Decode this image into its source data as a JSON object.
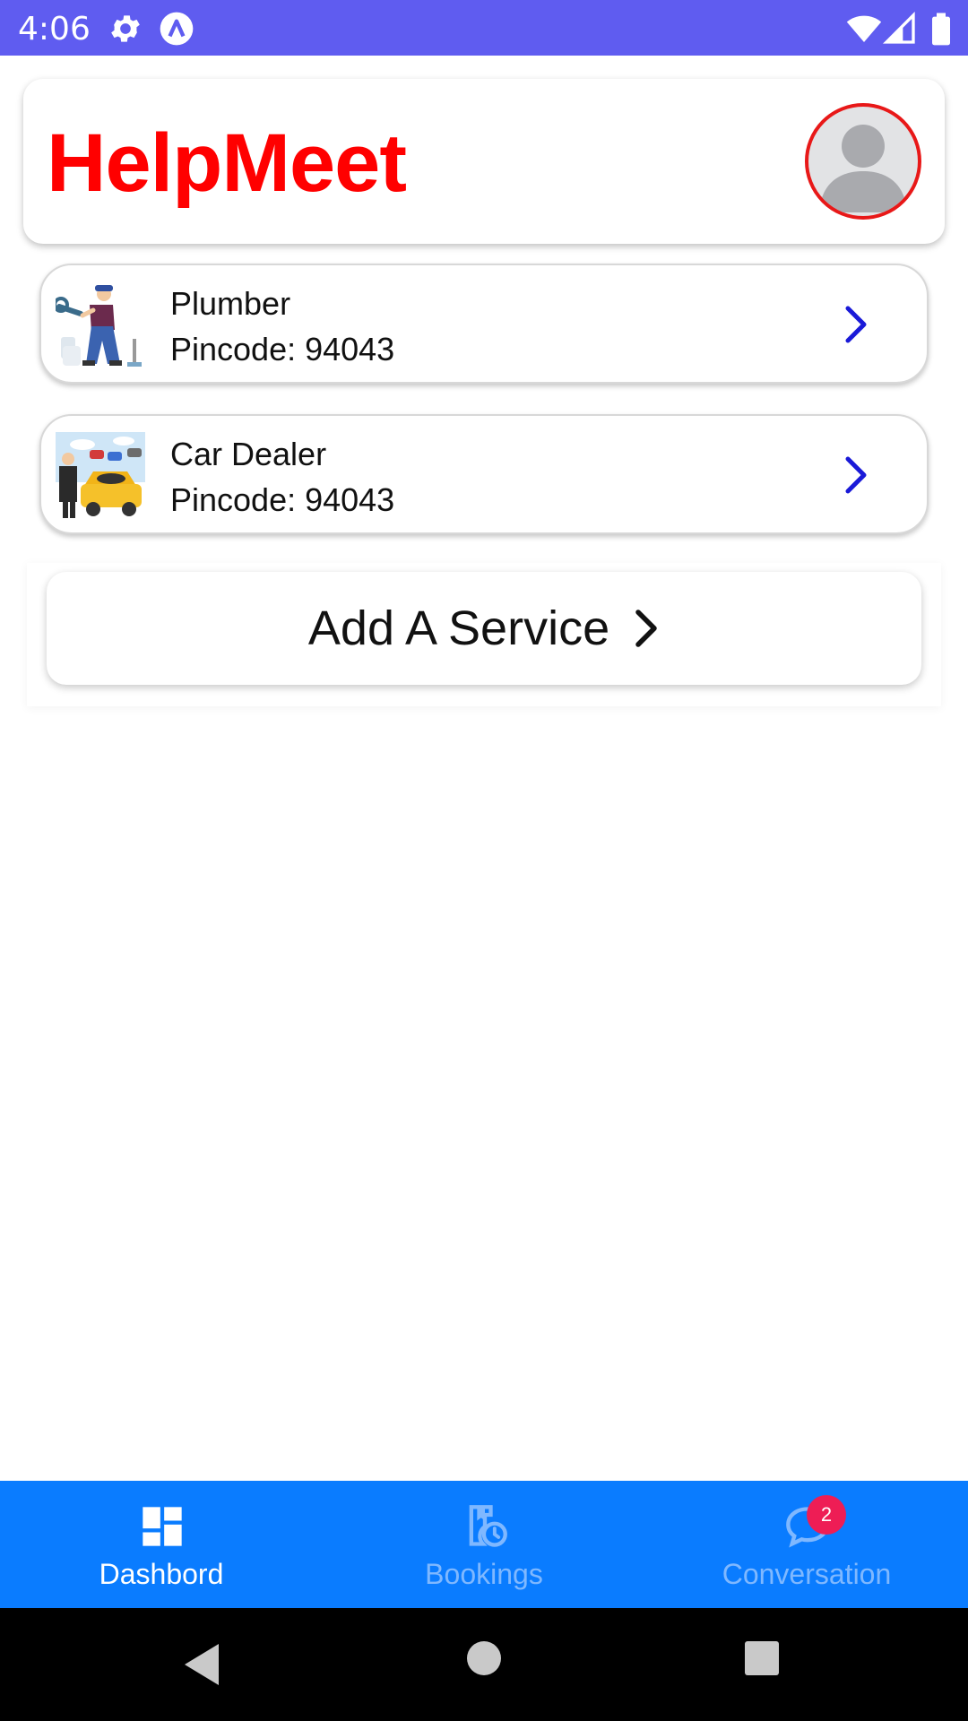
{
  "status_bar": {
    "time": "4:06",
    "icons": [
      "gear-icon",
      "app-logo-icon",
      "wifi-icon",
      "signal-icon",
      "battery-icon"
    ]
  },
  "header": {
    "title": "HelpMeet",
    "title_color": "#ff0000",
    "avatar_icon": "user-avatar-icon"
  },
  "services": [
    {
      "name": "Plumber",
      "pincode": "Pincode: 94043",
      "image": "plumber-thumbnail"
    },
    {
      "name": "Car Dealer",
      "pincode": "Pincode: 94043",
      "image": "car-dealer-thumbnail"
    }
  ],
  "add_service": {
    "label": "Add A Service"
  },
  "bottom_nav": {
    "background": "#0a7cff",
    "items": [
      {
        "label": "Dashbord",
        "icon": "dashboard-icon",
        "active": true
      },
      {
        "label": "Bookings",
        "icon": "bookings-icon",
        "active": false
      },
      {
        "label": "Conversation",
        "icon": "chat-icon",
        "active": false,
        "badge": "2"
      }
    ]
  },
  "system_nav": {
    "icons": [
      "back-icon",
      "home-icon",
      "recents-icon"
    ]
  }
}
